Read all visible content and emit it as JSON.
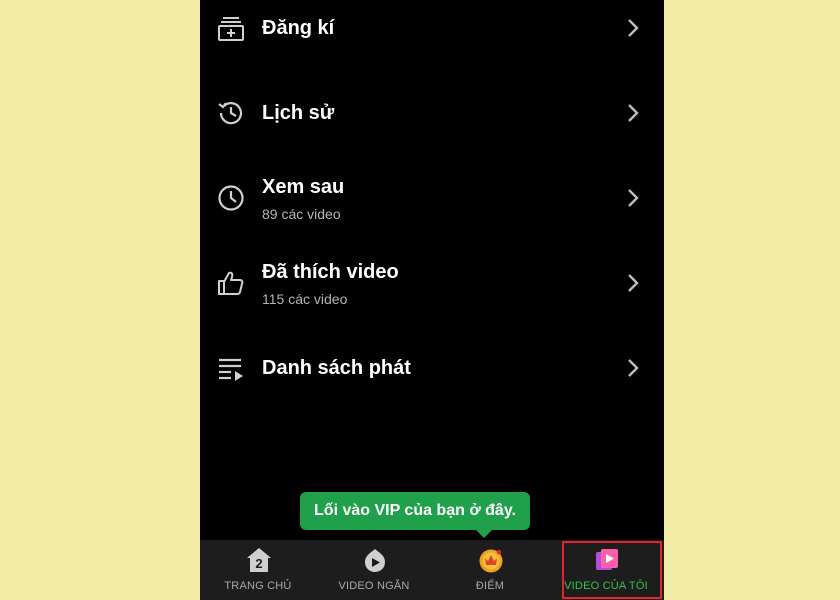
{
  "menu": {
    "items": [
      {
        "icon": "subscriptions-icon",
        "title": "Đăng kí",
        "subtitle": ""
      },
      {
        "icon": "history-icon",
        "title": "Lịch sử",
        "subtitle": ""
      },
      {
        "icon": "clock-icon",
        "title": "Xem sau",
        "subtitle": "89 các video"
      },
      {
        "icon": "thumbs-up-icon",
        "title": "Đã thích video",
        "subtitle": "115 các video"
      },
      {
        "icon": "playlist-icon",
        "title": "Danh sách phát",
        "subtitle": ""
      }
    ]
  },
  "tooltip": {
    "text": "Lối vào VIP của bạn ở đây."
  },
  "bottom_nav": {
    "tabs": [
      {
        "icon": "home-2-icon",
        "label": "TRANG CHỦ",
        "active": false
      },
      {
        "icon": "short-video-icon",
        "label": "VIDEO NGẮN",
        "active": false
      },
      {
        "icon": "crown-coin-icon",
        "label": "ĐIỂM",
        "active": false
      },
      {
        "icon": "my-video-icon",
        "label": "VIDEO CỦA TÔI",
        "active": true
      }
    ]
  },
  "colors": {
    "page_background": "#f2eca6",
    "screen_background": "#000000",
    "nav_background": "#1d1d1d",
    "tooltip_background": "#20a04a",
    "active_tab": "#37c24a",
    "highlight": "#e0242a"
  }
}
